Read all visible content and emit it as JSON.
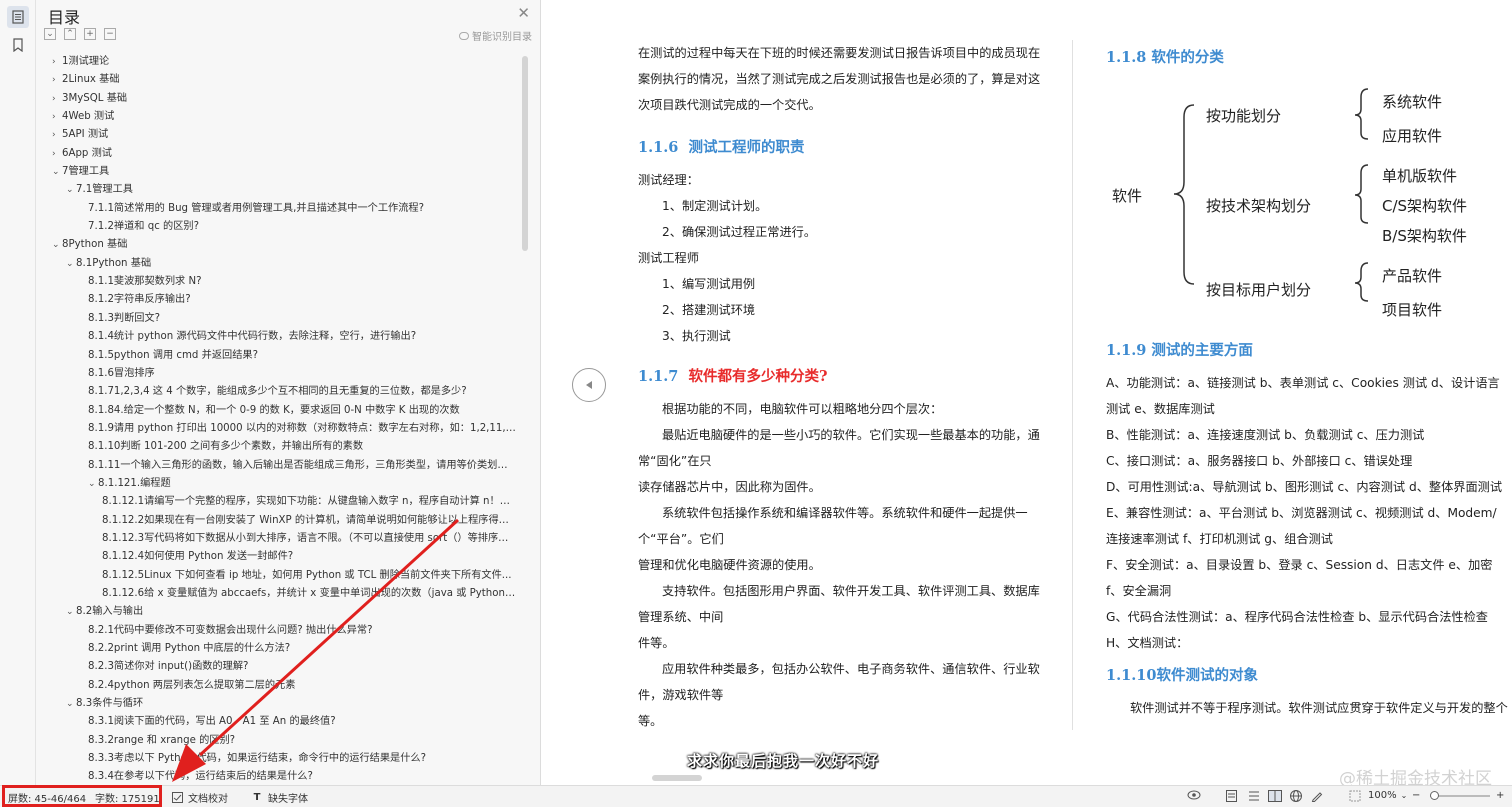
{
  "toc": {
    "title": "目录",
    "smart_label": "智能识别目录",
    "items": [
      {
        "text": "1测试理论",
        "level": 0,
        "arrow": "›"
      },
      {
        "text": "2Linux 基础",
        "level": 0,
        "arrow": "›"
      },
      {
        "text": "3MySQL 基础",
        "level": 0,
        "arrow": "›"
      },
      {
        "text": "4Web 测试",
        "level": 0,
        "arrow": "›"
      },
      {
        "text": "5API 测试",
        "level": 0,
        "arrow": "›"
      },
      {
        "text": "6App 测试",
        "level": 0,
        "arrow": "›"
      },
      {
        "text": "7管理工具",
        "level": 0,
        "arrow": "⌄"
      },
      {
        "text": "7.1管理工具",
        "level": 1,
        "arrow": "⌄"
      },
      {
        "text": "7.1.1简述常用的 Bug 管理或者用例管理工具,并且描述其中一个工作流程?",
        "level": 2,
        "arrow": ""
      },
      {
        "text": "7.1.2禅道和 qc 的区别?",
        "level": 2,
        "arrow": ""
      },
      {
        "text": "8Python 基础",
        "level": 0,
        "arrow": "⌄"
      },
      {
        "text": "8.1Python 基础",
        "level": 1,
        "arrow": "⌄"
      },
      {
        "text": "8.1.1斐波那契数列求 N?",
        "level": 2,
        "arrow": ""
      },
      {
        "text": "8.1.2字符串反序输出?",
        "level": 2,
        "arrow": ""
      },
      {
        "text": "8.1.3判断回文?",
        "level": 2,
        "arrow": ""
      },
      {
        "text": "8.1.4统计 python 源代码文件中代码行数，去除注释，空行，进行输出?",
        "level": 2,
        "arrow": ""
      },
      {
        "text": "8.1.5python 调用 cmd 并返回结果?",
        "level": 2,
        "arrow": ""
      },
      {
        "text": "8.1.6冒泡排序",
        "level": 2,
        "arrow": ""
      },
      {
        "text": "8.1.71,2,3,4 这 4 个数字，能组成多少个互不相同的且无重复的三位数，都是多少?",
        "level": 2,
        "arrow": ""
      },
      {
        "text": "8.1.84.给定一个整数 N，和一个 0-9 的数 K，要求返回 0-N 中数字 K 出现的次数",
        "level": 2,
        "arrow": ""
      },
      {
        "text": "8.1.9请用 python 打印出 10000 以内的对称数（对称数特点：数字左右对称，如：1,2,11,1...",
        "level": 2,
        "arrow": ""
      },
      {
        "text": "8.1.10判断 101-200 之间有多少个素数，并输出所有的素数",
        "level": 2,
        "arrow": ""
      },
      {
        "text": "8.1.11一个输入三角形的函数，输入后输出是否能组成三角形，三角形类型，请用等价类划分...",
        "level": 2,
        "arrow": ""
      },
      {
        "text": "8.1.121.编程题",
        "level": 2,
        "arrow": "⌄"
      },
      {
        "text": "8.1.12.1请编写一个完整的程序，实现如下功能：从键盘输入数字 n，程序自动计算 n！，...",
        "level": 3,
        "arrow": ""
      },
      {
        "text": "8.1.12.2如果现在有一台刚安装了 WinXP 的计算机，请简单说明如何能够让以上程序得以...",
        "level": 3,
        "arrow": ""
      },
      {
        "text": "8.1.12.3写代码将如下数据从小到大排序，语言不限。（不可以直接使用 sort（）等排序方...",
        "level": 3,
        "arrow": ""
      },
      {
        "text": "8.1.12.4如何使用 Python 发送一封邮件?",
        "level": 3,
        "arrow": ""
      },
      {
        "text": "8.1.12.5Linux 下如何查看 ip 地址，如何用 Python 或 TCL 删除当前文件夹下所有文件...",
        "level": 3,
        "arrow": ""
      },
      {
        "text": "8.1.12.6给 x 变量赋值为 abccaefs，并统计 x 变量中单词出现的次数（java 或 Python ...",
        "level": 3,
        "arrow": ""
      },
      {
        "text": "8.2输入与输出",
        "level": 1,
        "arrow": "⌄"
      },
      {
        "text": "8.2.1代码中要修改不可变数据会出现什么问题? 抛出什么异常?",
        "level": 2,
        "arrow": ""
      },
      {
        "text": "8.2.2print 调用 Python 中底层的什么方法?",
        "level": 2,
        "arrow": ""
      },
      {
        "text": "8.2.3简述你对 input()函数的理解?",
        "level": 2,
        "arrow": ""
      },
      {
        "text": "8.2.4python 两层列表怎么提取第二层的元素",
        "level": 2,
        "arrow": ""
      },
      {
        "text": "8.3条件与循环",
        "level": 1,
        "arrow": "⌄"
      },
      {
        "text": "8.3.1阅读下面的代码，写出 A0，A1 至 An 的最终值?",
        "level": 2,
        "arrow": ""
      },
      {
        "text": "8.3.2range 和 xrange 的区别?",
        "level": 2,
        "arrow": ""
      },
      {
        "text": "8.3.3考虑以下 Python 代码，如果运行结束，命令行中的运行结果是什么?",
        "level": 2,
        "arrow": ""
      },
      {
        "text": "8.3.4在参考以下代码，运行结束后的结果是什么?",
        "level": 2,
        "arrow": ""
      }
    ]
  },
  "doc": {
    "col1": {
      "intro": "在测试的过程中每天在下班的时候还需要发测试日报告诉项目中的成员现在案例执行的情况，当然了测试完成之后发测试报告也是必须的了，算是对这次项目跌代测试完成的一个交代。",
      "h116_num": "1.1.6",
      "h116_title": "测试工程师的职责",
      "manager_label": "测试经理：",
      "manager_items": [
        "1、制定测试计划。",
        "2、确保测试过程正常进行。"
      ],
      "engineer_label": "测试工程师",
      "engineer_items": [
        "1、编写测试用例",
        "2、搭建测试环境",
        "3、执行测试"
      ],
      "h117_num": "1.1.7",
      "h117_title": "软件都有多少种分类?",
      "p1": "根据功能的不同，电脑软件可以粗略地分四个层次：",
      "p2a": "最贴近电脑硬件的是一些小巧的软件。它们实现一些最基本的功能，通常“固化”在只",
      "p2b": "读存储器芯片中，因此称为固件。",
      "p3a": "系统软件包括操作系统和编译器软件等。系统软件和硬件一起提供一个“平台”。它们",
      "p3b": "管理和优化电脑硬件资源的使用。",
      "p4a": "支持软件。包括图形用户界面、软件开发工具、软件评测工具、数据库管理系统、中间",
      "p4b": "件等。",
      "p5a": "应用软件种类最多，包括办公软件、电子商务软件、通信软件、行业软件，游戏软件等",
      "p5b": "等。"
    },
    "col2": {
      "h118": "1.1.8  软件的分类",
      "mindmap": {
        "root": "软件",
        "b1": "按功能划分",
        "b1_items": [
          "系统软件",
          "应用软件"
        ],
        "b2": "按技术架构划分",
        "b2_items": [
          "单机版软件",
          "C/S架构软件",
          "B/S架构软件"
        ],
        "b3": "按目标用户划分",
        "b3_items": [
          "产品软件",
          "项目软件"
        ]
      },
      "h119": "1.1.9  测试的主要方面",
      "lines": [
        "A、功能测试：a、链接测试  b、表单测试  c、Cookies 测试  d、设计语言测试  e、数据库测试",
        "B、性能测试：a、连接速度测试  b、负载测试  c、压力测试",
        "C、接口测试：a、服务器接口  b、外部接口  c、错误处理",
        "D、可用性测试:a、导航测试  b、图形测试  c、内容测试  d、整体界面测试",
        "E、兼容性测试：a、平台测试  b、浏览器测试  c、视频测试  d、Modem/连接速率测试  f、打印机测试  g、组合测试",
        "F、安全测试：a、目录设置  b、登录  c、Session d、日志文件  e、加密  f、安全漏洞",
        "G、代码合法性测试：a、程序代码合法性检查  b、显示代码合法性检查",
        "H、文档测试："
      ],
      "h1110": "1.1.10软件测试的对象",
      "last": "软件测试并不等于程序测试。软件测试应贯穿于软件定义与开发的整个期"
    },
    "subtitle": "求求你最后抱我一次好不好",
    "watermark": "@稀土掘金技术社区"
  },
  "status": {
    "screen": "屏数: 45-46/464",
    "words": "字数: 175191",
    "proofread": "文档校对",
    "missing_font": "缺失字体",
    "zoom": "100%"
  },
  "colors": {
    "heading": "#3e8bd0",
    "heading_red": "#e82c2c",
    "highlight": "#e0201e"
  }
}
